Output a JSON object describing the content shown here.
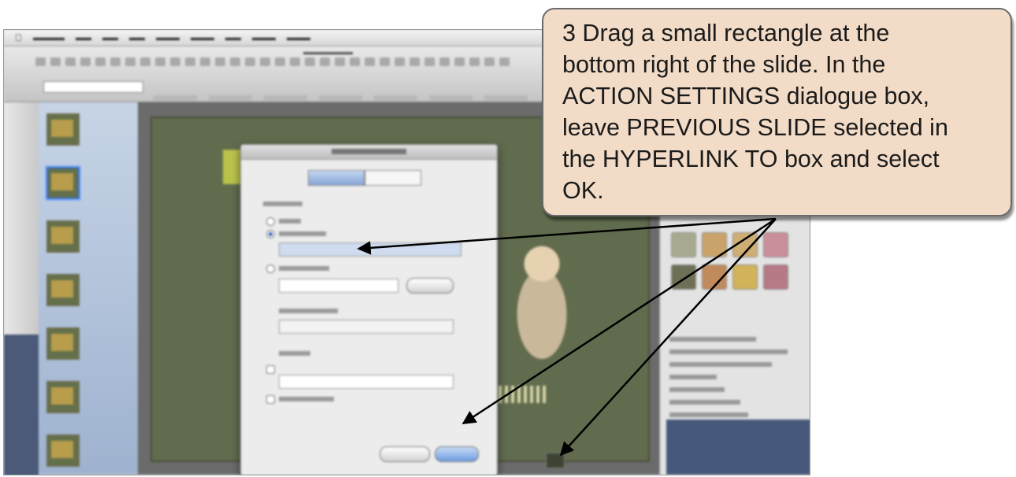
{
  "instruction": {
    "text": "3  Drag a small rectangle at the\n    bottom right of the slide.  In the\n    ACTION SETTINGS dialogue box,\n    leave PREVIOUS SLIDE selected in\n    the HYPERLINK TO box and select\n    OK."
  },
  "colors": {
    "callout_fill": "#f2dcc7",
    "callout_border": "#6b6b6b",
    "arrow": "#000000",
    "slide_background": "#616b4e",
    "selected_thumbnail": "#2f6ed8"
  },
  "icons": {
    "menubar": "apple-icon"
  },
  "slide_thumbnails": [
    {
      "state": "normal"
    },
    {
      "state": "selected"
    },
    {
      "state": "normal"
    },
    {
      "state": "normal"
    },
    {
      "state": "normal"
    },
    {
      "state": "normal"
    },
    {
      "state": "normal"
    }
  ],
  "style_swatch_colors": [
    "#a8aa90",
    "#c9a36a",
    "#cfae74",
    "#c98f9a",
    "#6d6f57",
    "#c08a5c",
    "#d2b35a",
    "#b57a86"
  ]
}
